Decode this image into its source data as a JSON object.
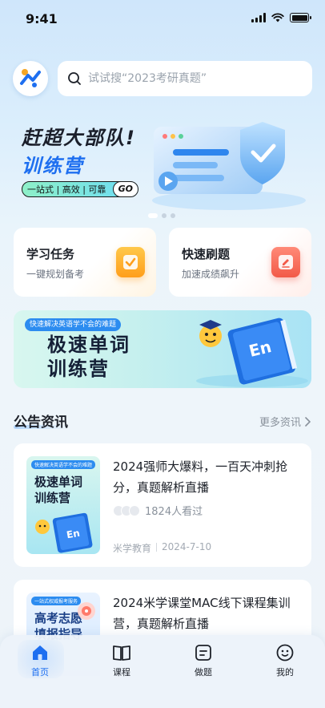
{
  "status_bar": {
    "time": "9:41"
  },
  "search": {
    "placeholder": "试试搜“2023考研真题”"
  },
  "banner": {
    "title": "赶超大部队!",
    "subtitle": "训练营",
    "tagline": "一站式 | 高效 | 可靠",
    "go_label": "GO",
    "slides_total": 3,
    "slide_active": 1
  },
  "task_cards": [
    {
      "title": "学习任务",
      "desc": "一键规划备考",
      "icon": "checkmark-icon"
    },
    {
      "title": "快速刷题",
      "desc": "加速成绩飙升",
      "icon": "pencil-icon"
    }
  ],
  "vocab_banner": {
    "tag": "快速解决英语学不会的难题",
    "title_line1": "极速单词",
    "title_line2": "训练营",
    "book_label": "En"
  },
  "announcements": {
    "title": "公告资讯",
    "more_label": "更多资讯",
    "items": [
      {
        "title": "2024强师大爆料，一百天冲刺抢分，真题解析直播",
        "views": "1824人看过",
        "source": "米学教育",
        "date": "2024-7-10",
        "thumb_tag": "快速解决英语学不会的难题",
        "thumb_title_1": "极速单词",
        "thumb_title_2": "训练营",
        "thumb_book": "En"
      },
      {
        "title": "2024米学课堂MAC线下课程集训营，真题解析直播",
        "thumb_tag": "一站式权威报考服务",
        "thumb_title_1": "高考志愿",
        "thumb_title_2": "填报指导"
      }
    ]
  },
  "tabbar": {
    "items": [
      {
        "label": "首页",
        "icon": "home-icon",
        "active": true
      },
      {
        "label": "课程",
        "icon": "book-icon",
        "active": false
      },
      {
        "label": "做题",
        "icon": "practice-icon",
        "active": false
      },
      {
        "label": "我的",
        "icon": "profile-icon",
        "active": false
      }
    ]
  },
  "colors": {
    "accent": "#1e6ff0",
    "orange": "#ff9e1b",
    "red": "#f25a48"
  }
}
